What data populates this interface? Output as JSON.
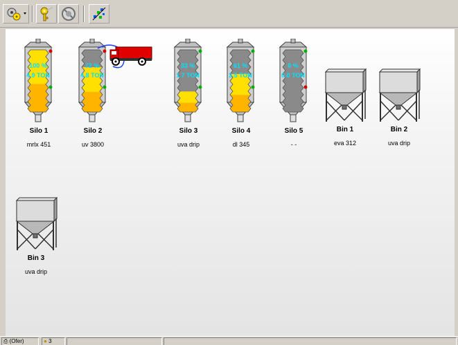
{
  "toolbar": {
    "buttons": [
      {
        "icon": "gear-icon"
      },
      {
        "icon": "key-icon"
      },
      {
        "icon": "no-entry-icon"
      },
      {
        "icon": "scatter-icon"
      }
    ]
  },
  "silos": [
    {
      "name": "Silo 1",
      "sub": "mrlx 451",
      "percent": "100 %",
      "tons": "4.9 TON",
      "fill": 1.0,
      "top_led": "#d00000",
      "bottom_led": "#00b000"
    },
    {
      "name": "Silo 2",
      "sub": "uv 3800",
      "percent": "72 %",
      "tons": "4.8 TON",
      "fill": 0.72,
      "top_led": "#d00000",
      "bottom_led": "#00b000"
    },
    {
      "name": "Silo 3",
      "sub": "uva drip",
      "percent": "33 %",
      "tons": "1.7 TON",
      "fill": 0.33,
      "top_led": "#00b000",
      "bottom_led": "#00b000"
    },
    {
      "name": "Silo 4",
      "sub": "dl 345",
      "percent": "61 %",
      "tons": "2.5 TON",
      "fill": 0.61,
      "top_led": "#00b000",
      "bottom_led": "#00b000"
    },
    {
      "name": "Silo 5",
      "sub": "- -",
      "percent": "0 %",
      "tons": "0.0 TON",
      "fill": 0.0,
      "top_led": "#00b000",
      "bottom_led": "#d00000"
    }
  ],
  "bins": [
    {
      "name": "Bin 1",
      "sub": "eva 312"
    },
    {
      "name": "Bin 2",
      "sub": "uva drip"
    },
    {
      "name": "Bin 3",
      "sub": "uva drip"
    }
  ],
  "statusbar": {
    "connection": "(Ofer)",
    "count": "3"
  },
  "colors": {
    "fill_yellow": "#ffe000",
    "fill_orange": "#ffaa00",
    "empty_gray": "#8a8a8a",
    "text_cyan": "#00e0ff",
    "truck_red": "#e00000"
  }
}
